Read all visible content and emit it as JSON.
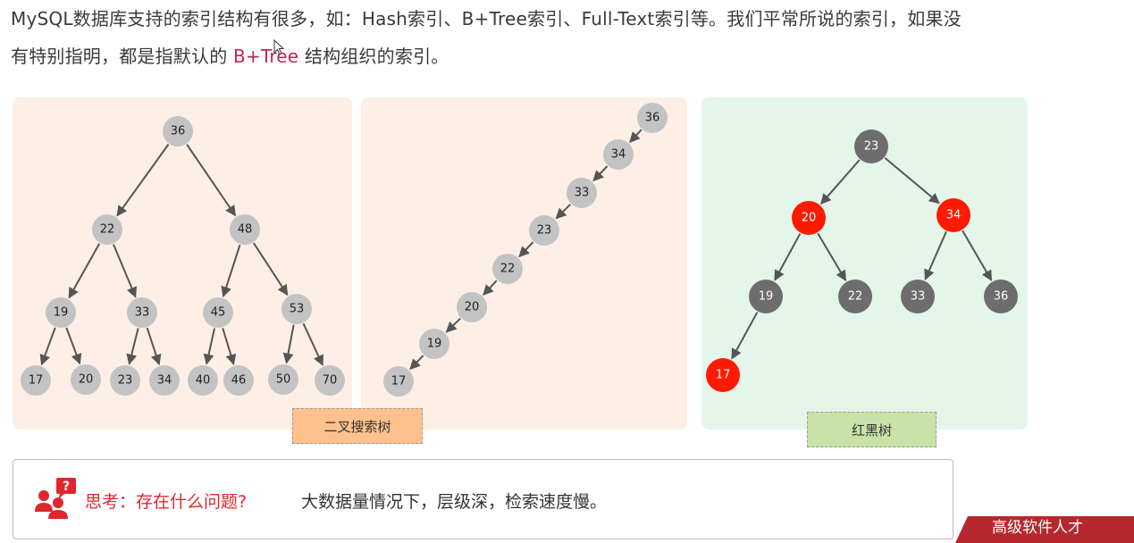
{
  "intro": {
    "line1": "MySQL数据库支持的索引结构有很多，如：Hash索引、B+Tree索引、Full-Text索引等。我们平常所说的索引，如果没",
    "line2_before": "有特别指明，都是指默认的 ",
    "line2_highlight": "B+Tree",
    "line2_after": " 结构组织的索引。"
  },
  "trees": {
    "bst": {
      "label": "二叉搜索树",
      "nodes": [
        "36",
        "22",
        "48",
        "19",
        "33",
        "45",
        "53",
        "17",
        "20",
        "23",
        "34",
        "40",
        "46",
        "50",
        "70"
      ]
    },
    "skewed": {
      "nodes": [
        "36",
        "34",
        "33",
        "23",
        "22",
        "20",
        "19",
        "17"
      ]
    },
    "red_black": {
      "label": "红黑树",
      "nodes": [
        {
          "value": "23",
          "color": "black"
        },
        {
          "value": "20",
          "color": "red"
        },
        {
          "value": "34",
          "color": "red"
        },
        {
          "value": "19",
          "color": "black"
        },
        {
          "value": "22",
          "color": "black"
        },
        {
          "value": "33",
          "color": "black"
        },
        {
          "value": "36",
          "color": "black"
        },
        {
          "value": "17",
          "color": "red"
        }
      ]
    }
  },
  "colors": {
    "gray_node": "#c3c3c3",
    "black_node": "#6d6d6d",
    "red_node": "#ff1a00",
    "highlight_text": "#c7254e",
    "think_red": "#e0262d"
  },
  "think": {
    "label": "思考：存在什么问题?",
    "answer": "大数据量情况下，层级深，检索速度慢。"
  },
  "corner": {
    "text": "高级软件人才"
  }
}
